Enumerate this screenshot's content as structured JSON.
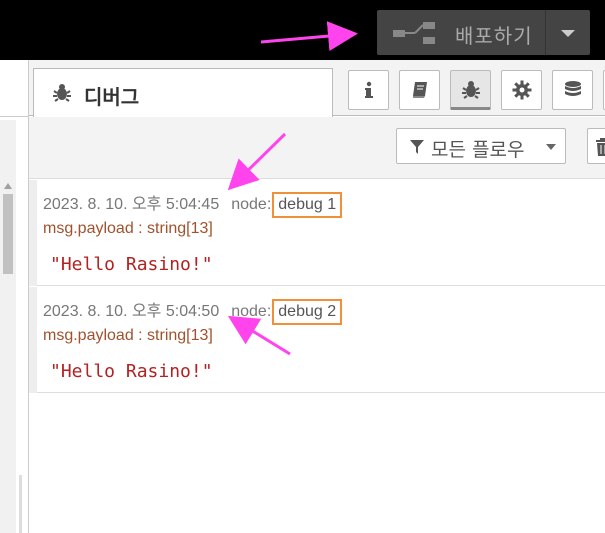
{
  "header": {
    "deploy_label": "배포하기"
  },
  "sidebar_tab": {
    "label": "디버그"
  },
  "toolbar": {
    "filter_label": "모든 플로우"
  },
  "messages": [
    {
      "timestamp": "2023. 8. 10. 오후 5:04:45",
      "node_prefix": "node:",
      "node_name": "debug 1",
      "path": "msg.payload : string[13]",
      "payload": "\"Hello Rasino!\""
    },
    {
      "timestamp": "2023. 8. 10. 오후 5:04:50",
      "node_prefix": "node:",
      "node_name": "debug 2",
      "path": "msg.payload : string[13]",
      "payload": "\"Hello Rasino!\""
    }
  ],
  "colors": {
    "topbar": "#000000",
    "deploy_bg": "#444444",
    "node_highlight": "#f0913a",
    "payload_text": "#b22222",
    "annotation_arrow": "#ff44ee"
  },
  "icons": {
    "deploy": "deploy-flow-icon",
    "deploy_menu": "caret-down-icon",
    "debug": "bug-icon",
    "info": "info-icon",
    "help": "book-icon",
    "config": "gear-icon",
    "context": "database-icon",
    "filter": "filter-icon",
    "clear": "trash-icon"
  }
}
